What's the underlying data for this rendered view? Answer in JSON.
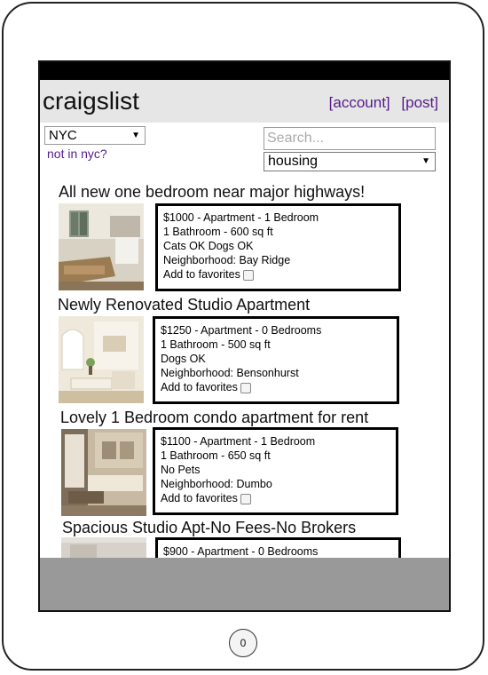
{
  "header": {
    "logo": "craigslist",
    "account_link": "[account]",
    "post_link": "[post]"
  },
  "location": {
    "selected_city": "NYC",
    "not_in_city_link": "not in nyc?"
  },
  "search": {
    "placeholder": "Search...",
    "category": "housing"
  },
  "listings": [
    {
      "title": "All new one bedroom near major highways!",
      "line1": "$1000 - Apartment - 1 Bedroom",
      "line2": "1 Bathroom - 600 sq ft",
      "line3": "Cats OK Dogs OK",
      "line4": "Neighborhood: Bay Ridge",
      "favorite_label": "Add to favorites"
    },
    {
      "title": "Newly Renovated Studio Apartment",
      "line1": "$1250 - Apartment - 0 Bedrooms",
      "line2": "1 Bathroom - 500 sq ft",
      "line3": "Dogs OK",
      "line4": "Neighborhood: Bensonhurst",
      "favorite_label": "Add to favorites"
    },
    {
      "title": "Lovely 1 Bedroom condo apartment for rent",
      "line1": "$1100 - Apartment - 1 Bedroom",
      "line2": "1 Bathroom - 650 sq ft",
      "line3": "No Pets",
      "line4": "Neighborhood: Dumbo",
      "favorite_label": "Add to favorites"
    },
    {
      "title": "Spacious Studio Apt-No Fees-No Brokers",
      "line1": "$900 - Apartment - 0 Bedrooms"
    }
  ],
  "device": {
    "home_button": "0"
  },
  "colors": {
    "link": "#551a8b",
    "header_bg": "#e6e6e6",
    "bottom_bar": "#999999"
  }
}
